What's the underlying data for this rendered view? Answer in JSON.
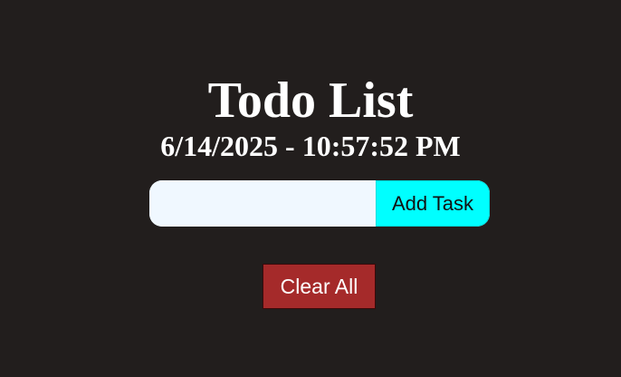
{
  "app": {
    "title": "Todo List",
    "datetime": "6/14/2025 - 10:57:52 PM"
  },
  "task_form": {
    "input_value": "",
    "input_placeholder": "",
    "add_label": "Add Task"
  },
  "tasks": [],
  "actions": {
    "clear_label": "Clear All"
  },
  "colors": {
    "background": "#221e1d",
    "title_text": "#ffffff",
    "input_background": "#f0f8ff",
    "add_button": "#00ffff",
    "clear_button": "#a52a2a",
    "clear_text": "#ffffff"
  }
}
